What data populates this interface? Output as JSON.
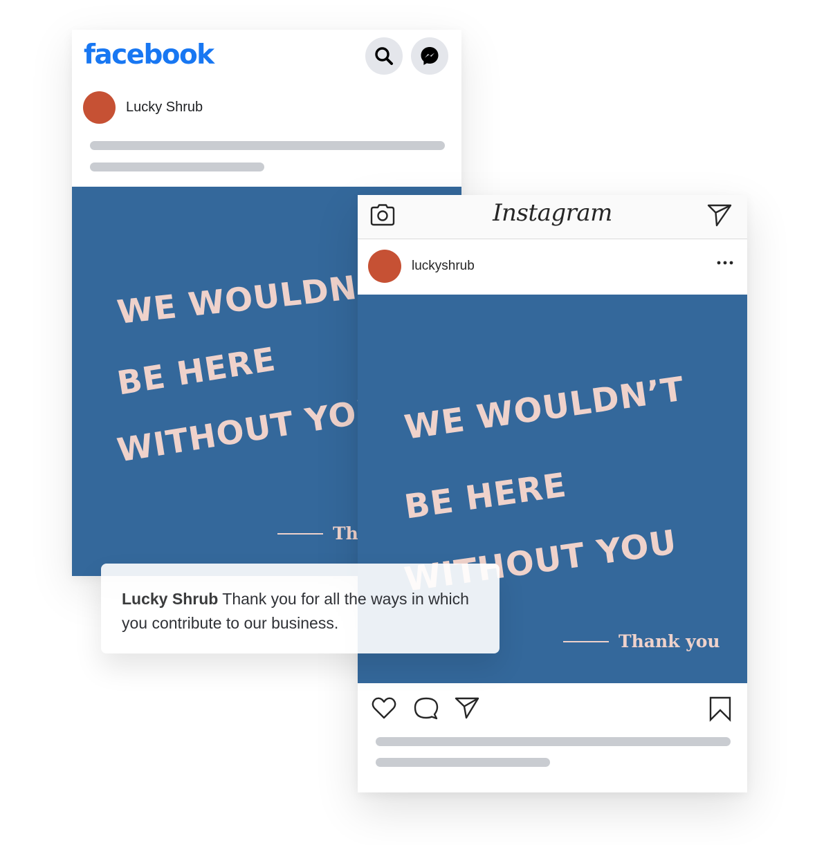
{
  "colors": {
    "facebook_blue": "#1877f2",
    "post_background": "#34689b",
    "post_text": "#efd2cb",
    "avatar": "#c65134",
    "skeleton": "#c9ccd1",
    "icon_dark": "#262626"
  },
  "facebook": {
    "logo": "facebook",
    "icons": {
      "search": "search-icon",
      "messenger": "messenger-icon"
    },
    "page_name": "Lucky Shrub",
    "post_image": {
      "lines": [
        "WE WOULDN’T",
        "BE HERE",
        "WITHOUT YOU"
      ],
      "signature": "Thank you"
    }
  },
  "instagram": {
    "logo": "Instagram",
    "icons": {
      "camera": "camera-icon",
      "direct": "direct-message-icon",
      "more": "more-options-icon",
      "like": "heart-icon",
      "comment": "comment-icon",
      "share": "share-icon",
      "save": "bookmark-icon"
    },
    "username": "luckyshrub",
    "post_image": {
      "lines": [
        "WE WOULDN’T",
        "BE HERE",
        "WITHOUT YOU"
      ],
      "signature": "Thank you"
    }
  },
  "caption": {
    "author": "Lucky Shrub",
    "text": " Thank you for all the ways in which you contribute to our business."
  }
}
